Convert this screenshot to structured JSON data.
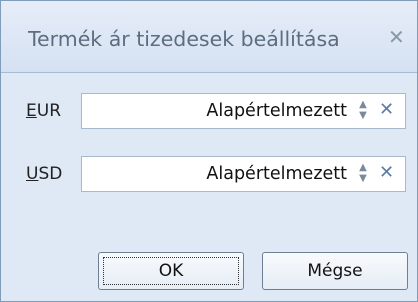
{
  "dialog": {
    "title": "Termék ár tizedesek beállítása",
    "close_label": "✕"
  },
  "rows": [
    {
      "label_mnemonic": "E",
      "label_rest": "UR",
      "value": "Alapértelmezett",
      "clear": "✕"
    },
    {
      "label_mnemonic": "U",
      "label_rest": "SD",
      "value": "Alapértelmezett",
      "clear": "✕"
    }
  ],
  "buttons": {
    "ok": "OK",
    "cancel": "Mégse"
  },
  "colors": {
    "dialog_bg": "#dfe8f5",
    "title_text": "#5d6d80",
    "clear_icon": "#5b7ca6"
  }
}
